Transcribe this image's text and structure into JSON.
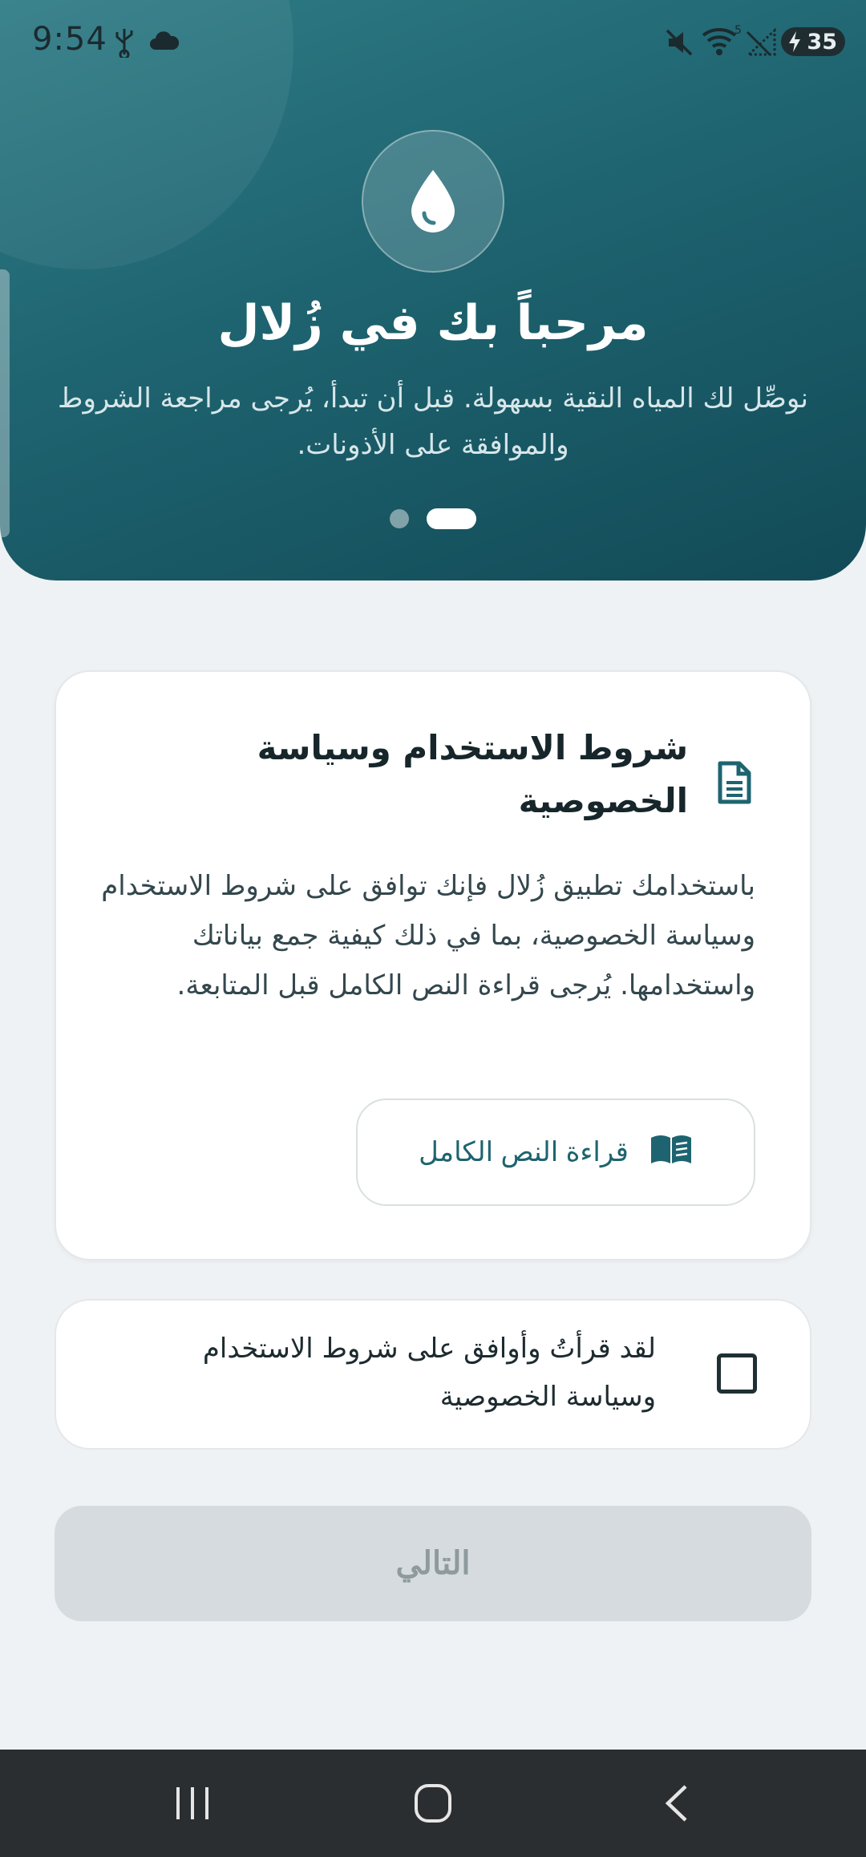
{
  "status_bar": {
    "time": "9:54",
    "battery": "35",
    "icons": [
      "usb-icon",
      "cloud-icon",
      "mute-icon",
      "wifi-icon",
      "signal-icon",
      "battery-icon"
    ]
  },
  "hero": {
    "icon": "water-drop-icon",
    "title": "مرحباً بك في زُلال",
    "subtitle": "نوصِّل لك المياه النقية بسهولة. قبل أن تبدأ، يُرجى مراجعة الشروط والموافقة على الأذونات.",
    "pager": {
      "count": 2,
      "active": 2
    }
  },
  "terms_card": {
    "icon": "document-icon",
    "title": "شروط الاستخدام وسياسة الخصوصية",
    "body": "باستخدامك تطبيق زُلال فإنك توافق على شروط الاستخدام وسياسة الخصوصية، بما في ذلك كيفية جمع بياناتك واستخدامها. يُرجى قراءة النص الكامل قبل المتابعة.",
    "read_button": {
      "label": "قراءة النص الكامل",
      "icon": "open-book-icon"
    }
  },
  "agreement": {
    "label": "لقد قرأتُ وأوافق على شروط الاستخدام وسياسة الخصوصية",
    "checked": false
  },
  "next_button": {
    "label": "التالي",
    "enabled": false
  },
  "colors": {
    "primary": "#1e6470",
    "hero_dark": "#124a57",
    "background": "#eef2f4",
    "disabled_button": "#d5dbde"
  },
  "nav_bar": [
    "recent-apps-icon",
    "home-icon",
    "back-icon"
  ]
}
